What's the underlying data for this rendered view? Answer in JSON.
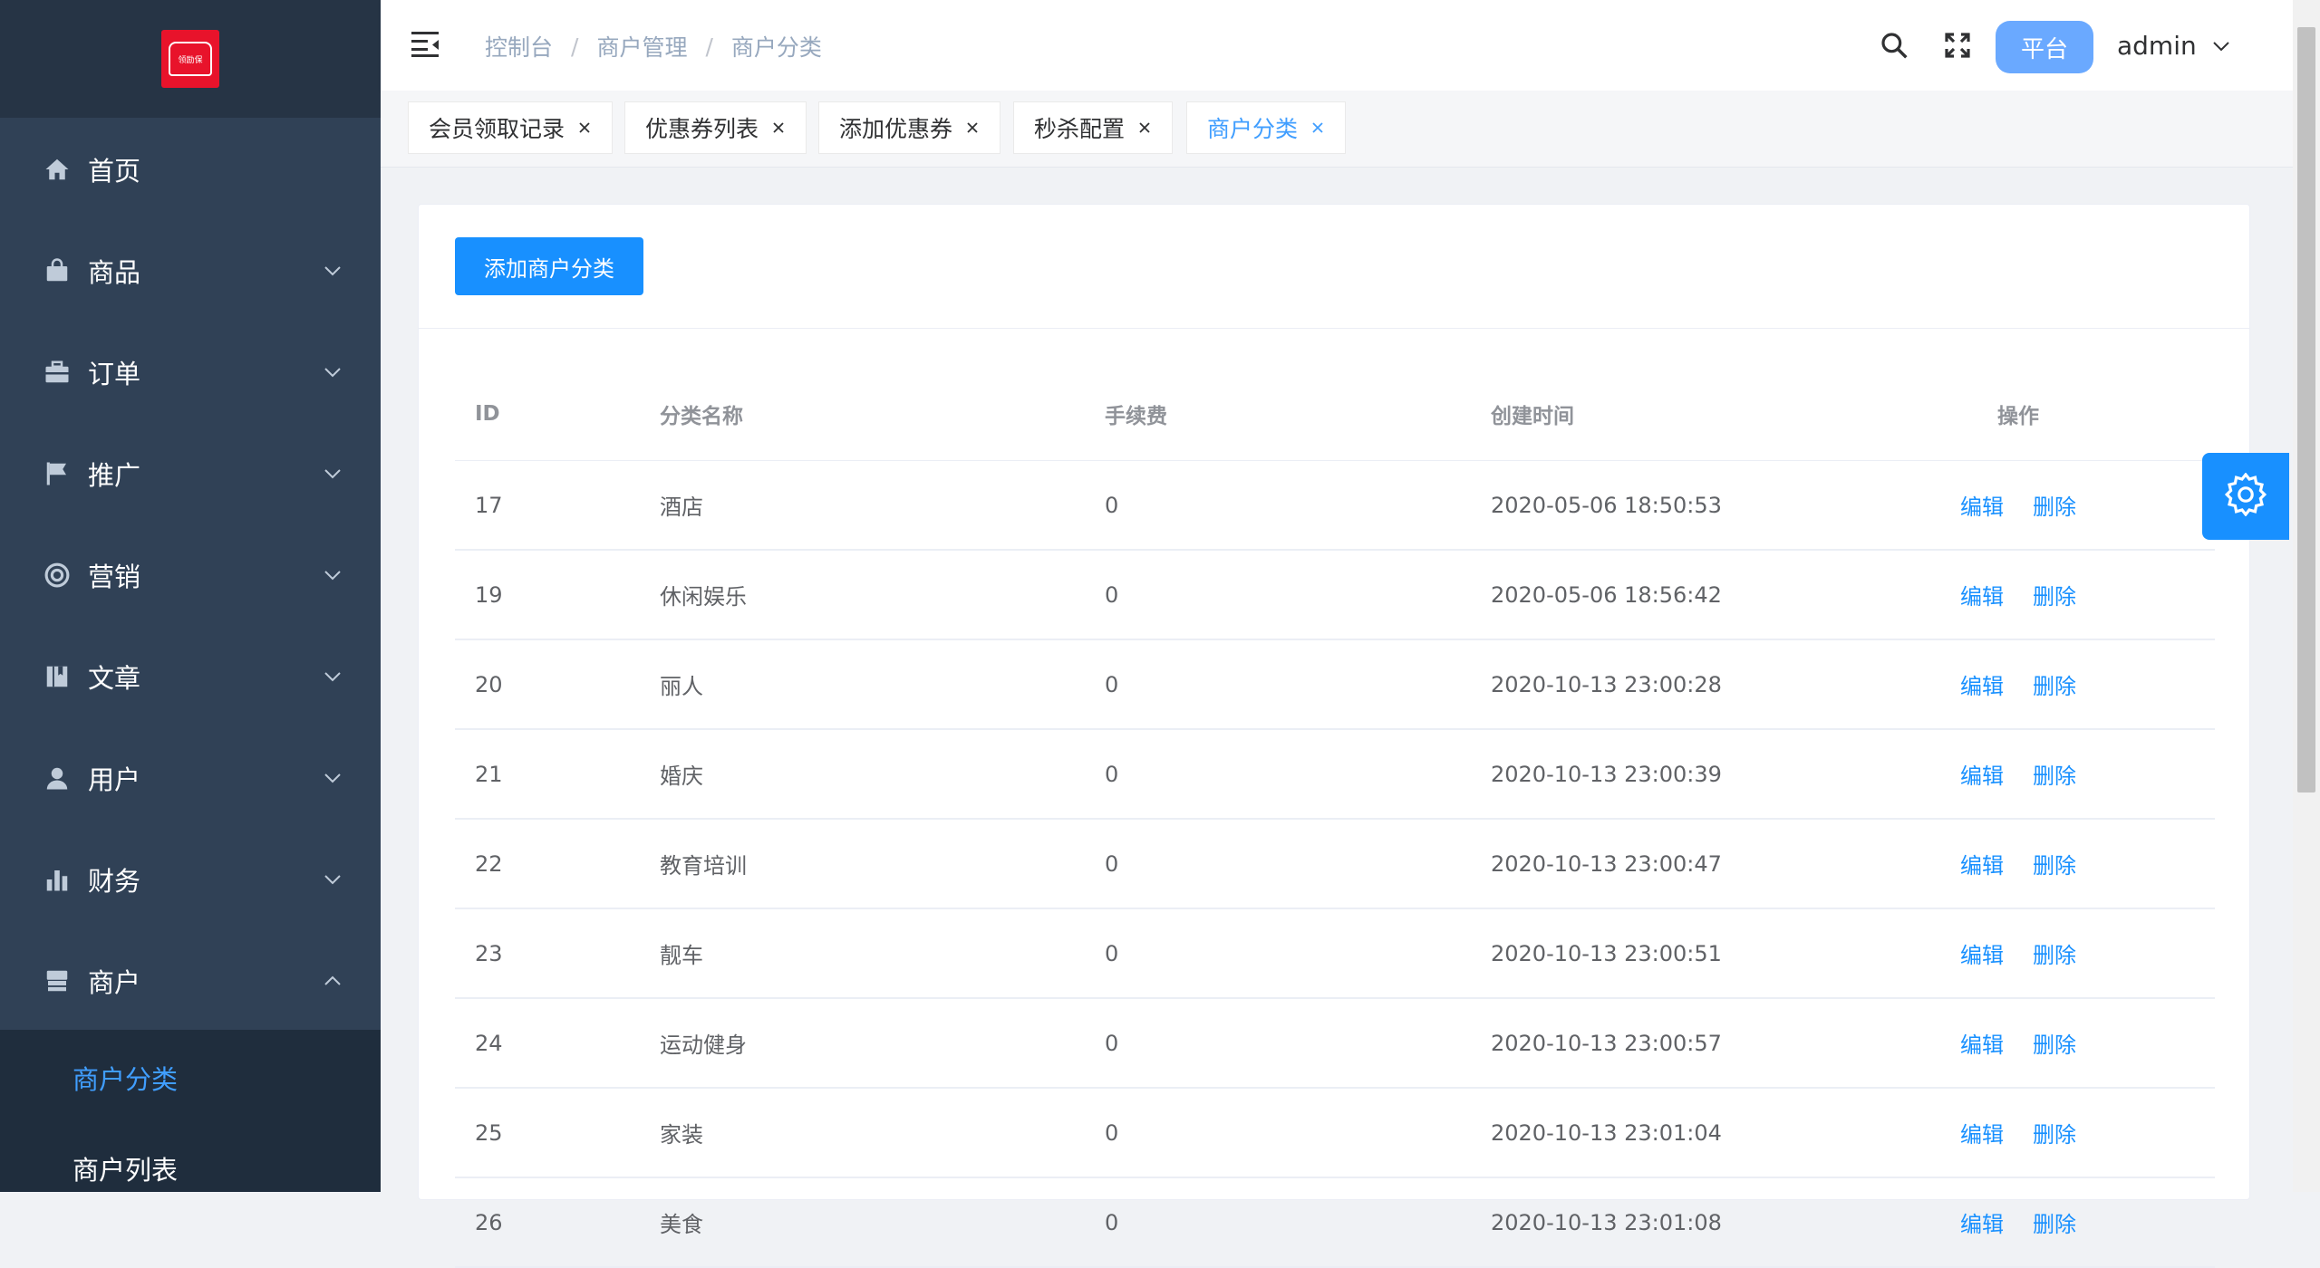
{
  "sidebar": {
    "logo_text": "领励保",
    "items": [
      {
        "label": "首页",
        "icon": "home-icon"
      },
      {
        "label": "商品",
        "icon": "shopping-bag-icon"
      },
      {
        "label": "订单",
        "icon": "briefcase-icon"
      },
      {
        "label": "推广",
        "icon": "flag-icon"
      },
      {
        "label": "营销",
        "icon": "lifebuoy-icon"
      },
      {
        "label": "文章",
        "icon": "book-icon"
      },
      {
        "label": "用户",
        "icon": "user-icon"
      },
      {
        "label": "财务",
        "icon": "bar-chart-icon"
      },
      {
        "label": "商户",
        "icon": "shop-icon"
      }
    ],
    "submenu": [
      {
        "label": "商户分类",
        "active": true
      },
      {
        "label": "商户列表",
        "active": false
      }
    ]
  },
  "header": {
    "breadcrumb": [
      "控制台",
      "商户管理",
      "商户分类"
    ],
    "platform_button": "平台",
    "username": "admin"
  },
  "tags": [
    {
      "label": "会员领取记录"
    },
    {
      "label": "优惠券列表"
    },
    {
      "label": "添加优惠券"
    },
    {
      "label": "秒杀配置"
    },
    {
      "label": "商户分类",
      "active": true
    }
  ],
  "main": {
    "add_button": "添加商户分类",
    "table": {
      "headers": [
        "ID",
        "分类名称",
        "手续费",
        "创建时间",
        "操作"
      ],
      "edit_label": "编辑",
      "delete_label": "删除",
      "rows": [
        {
          "id": "17",
          "name": "酒店",
          "fee": "0",
          "time": "2020-05-06 18:50:53"
        },
        {
          "id": "19",
          "name": "休闲娱乐",
          "fee": "0",
          "time": "2020-05-06 18:56:42"
        },
        {
          "id": "20",
          "name": "丽人",
          "fee": "0",
          "time": "2020-10-13 23:00:28"
        },
        {
          "id": "21",
          "name": "婚庆",
          "fee": "0",
          "time": "2020-10-13 23:00:39"
        },
        {
          "id": "22",
          "name": "教育培训",
          "fee": "0",
          "time": "2020-10-13 23:00:47"
        },
        {
          "id": "23",
          "name": "靓车",
          "fee": "0",
          "time": "2020-10-13 23:00:51"
        },
        {
          "id": "24",
          "name": "运动健身",
          "fee": "0",
          "time": "2020-10-13 23:00:57"
        },
        {
          "id": "25",
          "name": "家装",
          "fee": "0",
          "time": "2020-10-13 23:01:04"
        },
        {
          "id": "26",
          "name": "美食",
          "fee": "0",
          "time": "2020-10-13 23:01:08"
        }
      ]
    }
  },
  "colors": {
    "sidebar_bg": "#304156",
    "accent": "#1890ff",
    "active_text": "#409eff"
  }
}
